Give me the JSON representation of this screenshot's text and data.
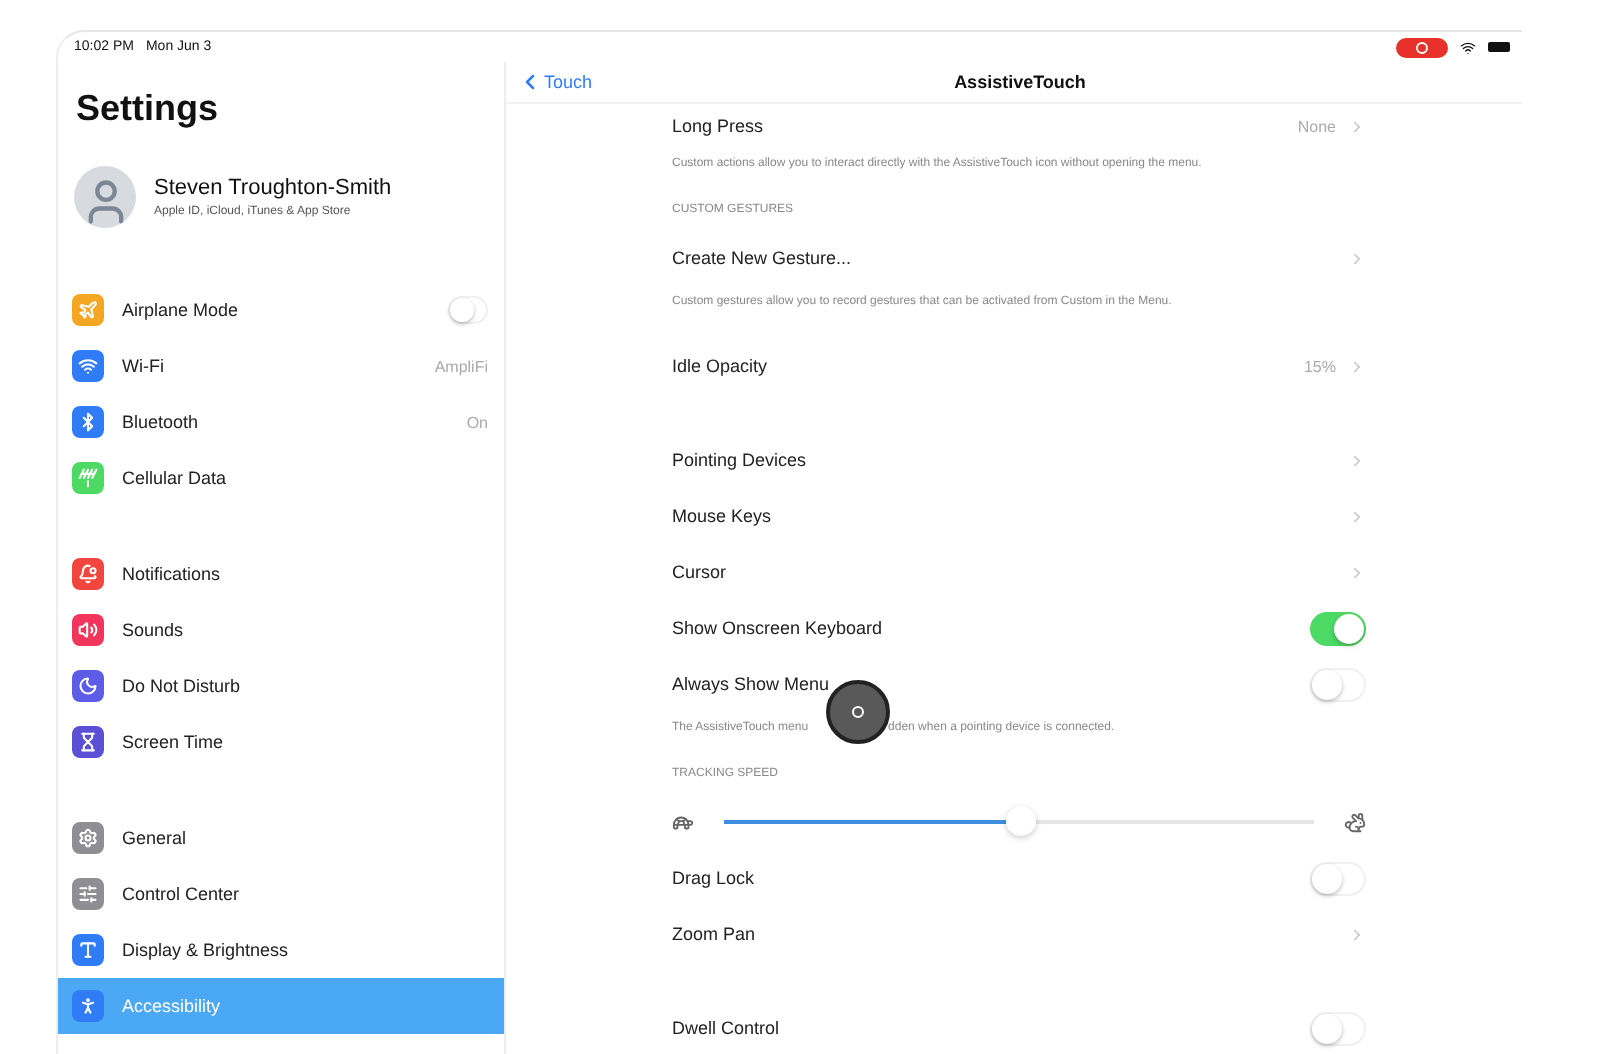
{
  "status_bar": {
    "time": "10:02 PM",
    "date": "Mon Jun 3",
    "recording": true
  },
  "sidebar": {
    "title": "Settings",
    "profile": {
      "name": "Steven Troughton-Smith",
      "subtitle": "Apple ID, iCloud, iTunes & App Store"
    },
    "groups": [
      [
        {
          "label": "Airplane Mode",
          "kind": "toggle",
          "on": false,
          "color": "#f5a623",
          "selected": false
        },
        {
          "label": "Wi-Fi",
          "kind": "link",
          "value": "AmpliFi",
          "color": "#2f7cf6",
          "selected": false
        },
        {
          "label": "Bluetooth",
          "kind": "link",
          "value": "On",
          "color": "#2f7cf6",
          "selected": false
        },
        {
          "label": "Cellular Data",
          "kind": "link",
          "color": "#4cd964",
          "selected": false
        }
      ],
      [
        {
          "label": "Notifications",
          "kind": "link",
          "color": "#f2453d",
          "selected": false
        },
        {
          "label": "Sounds",
          "kind": "link",
          "color": "#f2355b",
          "selected": false
        },
        {
          "label": "Do Not Disturb",
          "kind": "link",
          "color": "#5d5ce6",
          "selected": false
        },
        {
          "label": "Screen Time",
          "kind": "link",
          "color": "#5b4fd6",
          "selected": false
        }
      ],
      [
        {
          "label": "General",
          "kind": "link",
          "color": "#8e8e93",
          "selected": false
        },
        {
          "label": "Control Center",
          "kind": "link",
          "color": "#8e8e93",
          "selected": false
        },
        {
          "label": "Display & Brightness",
          "kind": "link",
          "color": "#2f7cf6",
          "selected": false
        },
        {
          "label": "Accessibility",
          "kind": "link",
          "color": "#2f7cf6",
          "selected": true
        }
      ]
    ]
  },
  "detail": {
    "back": "Touch",
    "title": "AssistiveTouch",
    "rows": [
      {
        "kind": "link",
        "label": "Long Press",
        "value": "None"
      },
      {
        "kind": "footer",
        "text": "Custom actions allow you to interact directly with the AssistiveTouch icon without opening the menu."
      },
      {
        "kind": "header",
        "text": "CUSTOM GESTURES"
      },
      {
        "kind": "link",
        "label": "Create New Gesture..."
      },
      {
        "kind": "footer",
        "text": "Custom gestures allow you to record gestures that can be activated from Custom in the Menu."
      },
      {
        "kind": "link",
        "label": "Idle Opacity",
        "value": "15%"
      },
      {
        "kind": "spacer"
      },
      {
        "kind": "link",
        "label": "Pointing Devices"
      },
      {
        "kind": "link",
        "label": "Mouse Keys"
      },
      {
        "kind": "link",
        "label": "Cursor"
      },
      {
        "kind": "toggle",
        "label": "Show Onscreen Keyboard",
        "on": true
      },
      {
        "kind": "toggle",
        "label": "Always Show Menu",
        "on": false
      },
      {
        "kind": "footer",
        "text": "The AssistiveTouch menu",
        "text_after": "dden when a pointing device is connected."
      },
      {
        "kind": "header",
        "text": "TRACKING SPEED"
      },
      {
        "kind": "slider",
        "level": 0.5
      },
      {
        "kind": "toggle",
        "label": "Drag Lock",
        "on": false
      },
      {
        "kind": "link",
        "label": "Zoom Pan"
      },
      {
        "kind": "spacer"
      },
      {
        "kind": "toggle",
        "label": "Dwell Control",
        "on": false
      }
    ]
  }
}
